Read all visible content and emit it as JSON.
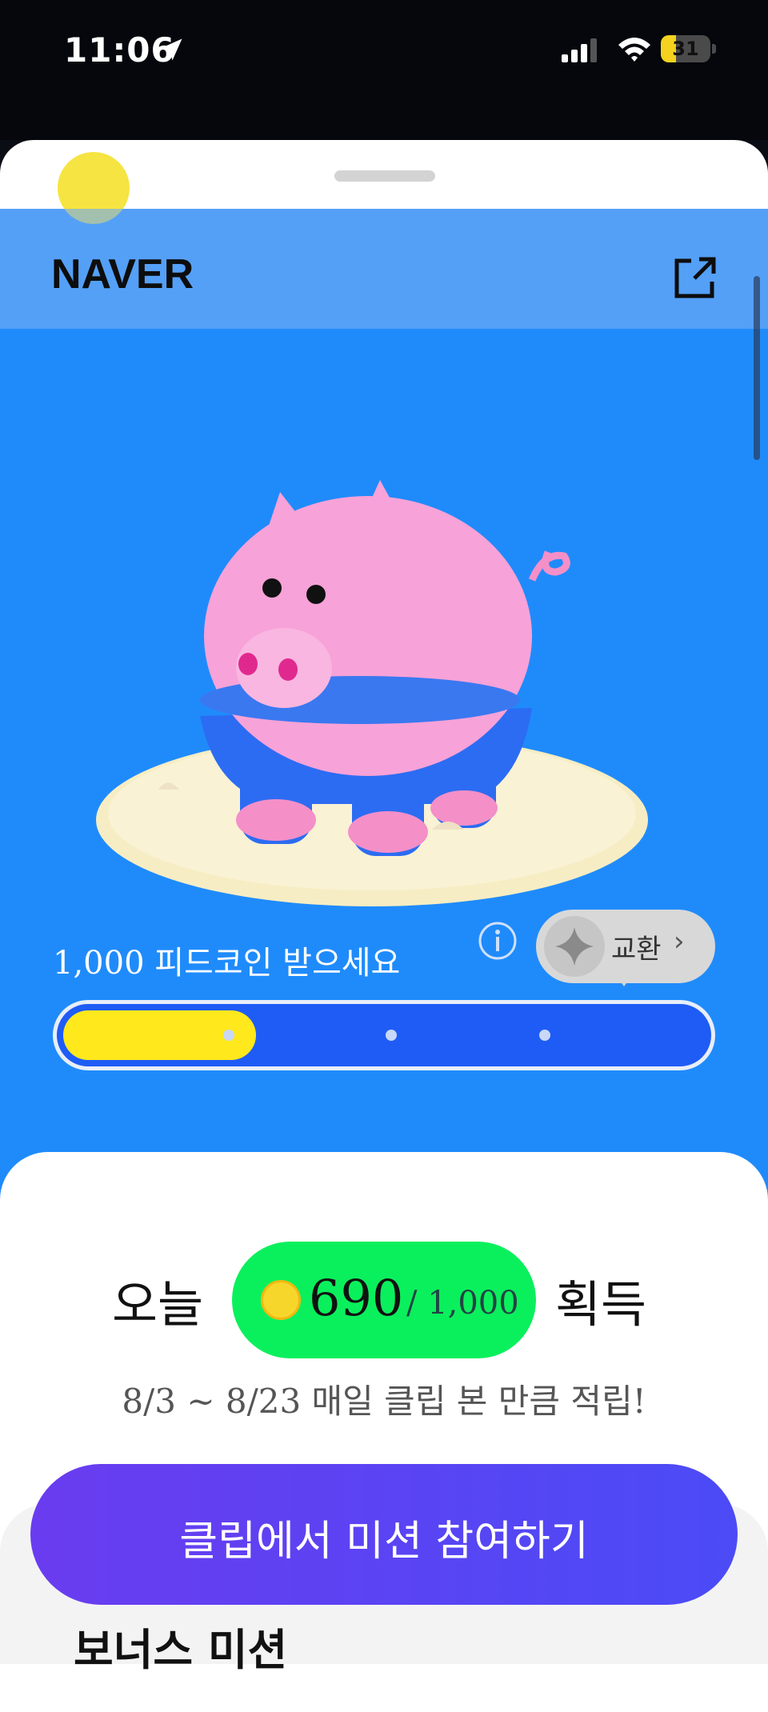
{
  "status_bar": {
    "time": "11:06",
    "battery": "31",
    "battery_level": 0.31
  },
  "header": {
    "logo": "NAVER",
    "share_icon": "external-link-icon"
  },
  "hero": {
    "reward_text": "1,000 피드코인 받으세요",
    "info_icon": "info-icon",
    "exchange_label": "교환",
    "exchange_chevron": "›",
    "progress_level": 0.3
  },
  "today": {
    "prefix": "오늘",
    "coins": "690",
    "max": "/ 1,000",
    "suffix": "획득",
    "period": "8/3 ~ 8/23 매일 클립 본 만큼 적립!"
  },
  "cta": {
    "label": "클립에서 미션 참여하기"
  },
  "bonus": {
    "title": "보너스 미션"
  },
  "colors": {
    "primary_blue": "#1f8bfb",
    "coin_green": "#0af05c",
    "progress_yellow": "#ffe81c",
    "cta_purple": "#5a44f2"
  }
}
